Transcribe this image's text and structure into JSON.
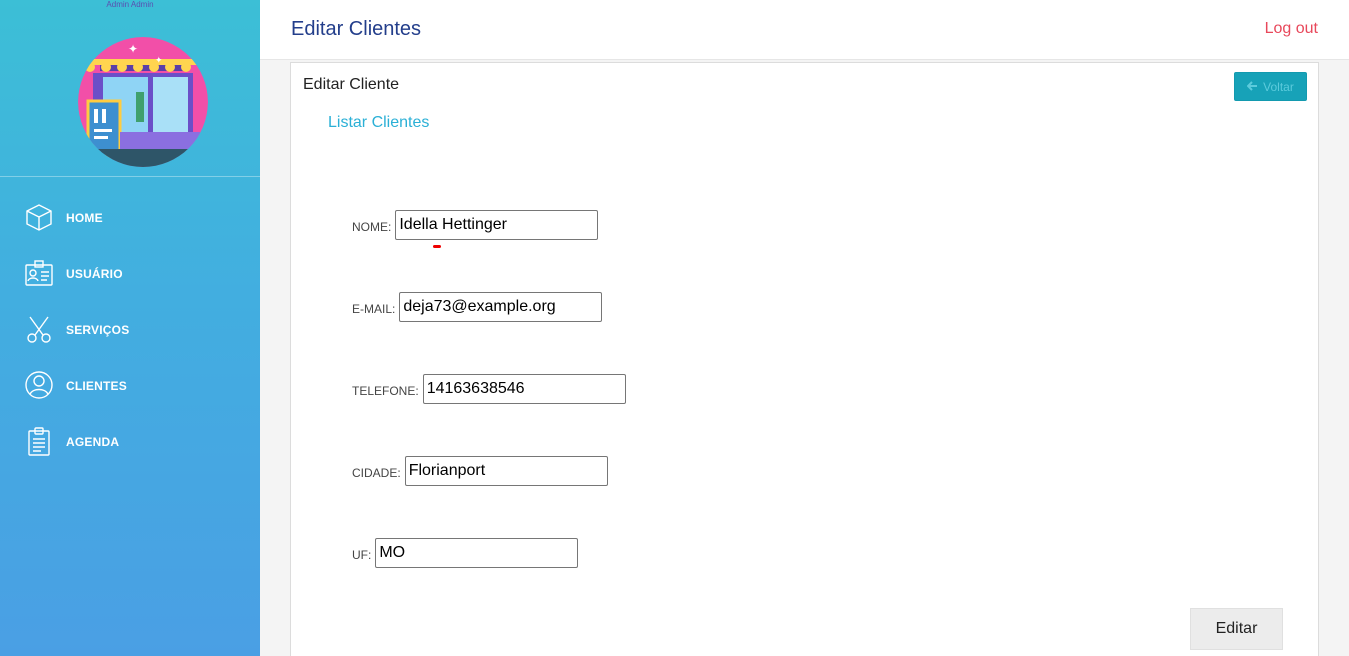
{
  "sidebar": {
    "user_label": "Admin Admin",
    "items": [
      {
        "label": "HOME",
        "icon": "box-icon"
      },
      {
        "label": "USUÁRIO",
        "icon": "id-card-icon"
      },
      {
        "label": "SERVIÇOS",
        "icon": "scissors-icon"
      },
      {
        "label": "CLIENTES",
        "icon": "user-circle-icon"
      },
      {
        "label": "AGENDA",
        "icon": "clipboard-icon"
      }
    ]
  },
  "header": {
    "title": "Editar Clientes",
    "logout_label": "Log out"
  },
  "card": {
    "title": "Editar Cliente",
    "back_label": "Voltar",
    "list_link": "Listar Clientes"
  },
  "form": {
    "nome_label": "NOME:",
    "nome_value": "Idella Hettinger",
    "email_label": "E-MAIL:",
    "email_value": "deja73@example.org",
    "telefone_label": "TELEFONE:",
    "telefone_value": "14163638546",
    "cidade_label": "CIDADE:",
    "cidade_value": "Florianport",
    "uf_label": "UF:",
    "uf_value": "MO",
    "submit_label": "Editar"
  },
  "colors": {
    "sidebar_top": "#3cbfd6",
    "sidebar_bottom": "#4a9fe4",
    "title": "#233e8b",
    "logout": "#e8485b",
    "link": "#2bb0d6",
    "back_button": "#17a2b8"
  }
}
